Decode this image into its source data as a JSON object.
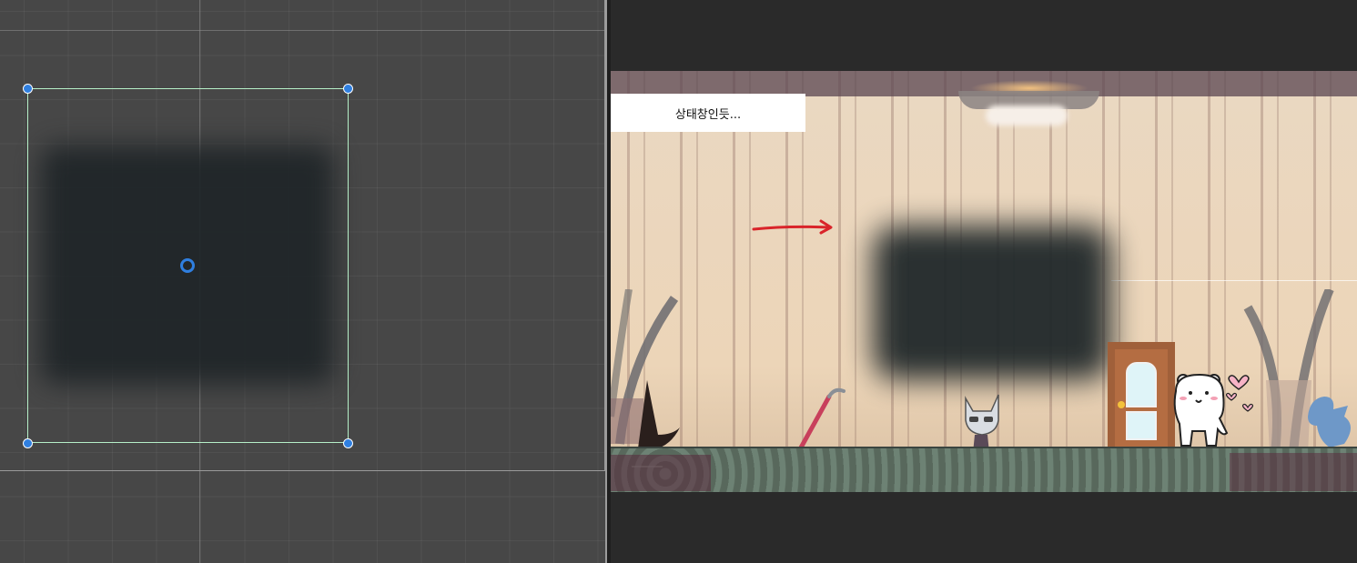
{
  "scene_view": {
    "rect_tool_color": "#b6f0c8",
    "handle_color": "#2f7fe0",
    "grid_color": "#474747",
    "icons": [
      "rect-handle-icon",
      "pivot-icon"
    ]
  },
  "game_view": {
    "status_text": "상태창인듯...",
    "background_color": "#2a2a2a",
    "accent_arrow_color": "#d9242a",
    "icons": [
      "red-arrow-icon",
      "crowbar-icon",
      "cat-character-icon",
      "bear-character-icon",
      "heart-icon",
      "bird-icon",
      "plant-icon",
      "door-icon",
      "lamp-icon"
    ]
  }
}
